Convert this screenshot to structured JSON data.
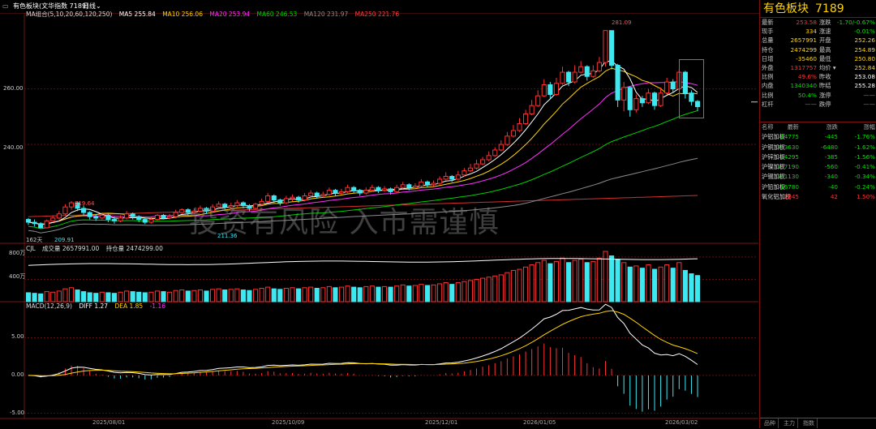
{
  "topbar": {
    "icon": "chart-icon",
    "title": "有色板块(文华指数 7189)",
    "period": "日线"
  },
  "legend_main": {
    "ma_group": "MA组合(5,10,20,60,120,250)",
    "ma5": "MA5 255.84",
    "ma10": "MA10 256.06",
    "ma20": "MA20 253.94",
    "ma60": "MA60 246.53",
    "ma120": "MA120 231.97",
    "ma250": "MA250 221.76"
  },
  "legend_vol": {
    "name": "CJL",
    "vol": "成交量 2657991.00",
    "oi": "持仓量 2474299.00"
  },
  "legend_macd": {
    "name": "MACD(12,26,9)",
    "diff": "DIFF 1.27",
    "dea": "DEA 1.85",
    "macd": "-1.16"
  },
  "axis": {
    "main_ticks": [
      "260.00",
      "240.00"
    ],
    "vol_ticks": [
      "800万",
      "400万"
    ],
    "macd_ticks": [
      "5.00",
      "0.00",
      "-5.00"
    ],
    "dates": [
      "2025/08/01",
      "2025/10/09",
      "2025/12/01",
      "2026/01/05",
      "2026/03/02"
    ]
  },
  "annotations": {
    "high": "281.09",
    "high_left": "219.64",
    "low_left": "209.91",
    "low_mid": "211.36",
    "bars_count": "162天"
  },
  "watermark": "投资有风险 入市需谨慎",
  "colors": {
    "up": "#ff3232",
    "down": "#3ee8f0",
    "ma5": "#ffffff",
    "ma10": "#ffd400",
    "ma20": "#ff30ff",
    "ma60": "#00d000",
    "ma120": "#8c8c8c",
    "ma250": "#d03030",
    "highlight": "#e0484a"
  },
  "quote": {
    "title": "有色板块",
    "code": "7189",
    "rows": [
      {
        "l": "最新",
        "v": "253.58",
        "vc": "#ff3232",
        "l2": "涨跌",
        "v2": "-1.70/-0.67%",
        "v2c": "#00e000"
      },
      {
        "l": "现手",
        "v": "334",
        "vc": "#ffd400",
        "l2": "涨速",
        "v2": "-0.01%",
        "v2c": "#00e000"
      },
      {
        "l": "总量",
        "v": "2657991",
        "vc": "#ffd400",
        "l2": "开盘",
        "v2": "252.26",
        "v2c": "#ffd400"
      },
      {
        "l": "持仓",
        "v": "2474299",
        "vc": "#ffd400",
        "l2": "最高",
        "v2": "254.89",
        "v2c": "#ffd400"
      },
      {
        "l": "日增",
        "v": "-35460",
        "vc": "#ffd400",
        "l2": "最低",
        "v2": "250.80",
        "v2c": "#ffd400"
      },
      {
        "l": "外盘",
        "v": "1317757",
        "vc": "#ff3232",
        "l2": "均价 ▾",
        "v2": "252.84",
        "v2c": "#ffd400"
      },
      {
        "l": "比例",
        "v": "49.6%",
        "vc": "#ff3232",
        "l2": "昨收",
        "v2": "253.08",
        "v2c": "#ffffff"
      },
      {
        "l": "内盘",
        "v": "1340340",
        "vc": "#00e000",
        "l2": "昨结",
        "v2": "255.28",
        "v2c": "#ffffff"
      },
      {
        "l": "比例",
        "v": "50.4%",
        "vc": "#00e000",
        "l2": "涨停",
        "v2": "——",
        "v2c": "#888888"
      },
      {
        "l": "杠杆",
        "v": "——",
        "vc": "#888888",
        "l2": "跌停",
        "v2": "——",
        "v2c": "#888888"
      }
    ],
    "list_header": [
      "名称",
      "最新",
      "涨跌",
      "涨幅"
    ],
    "list": [
      {
        "name": "沪铝加权",
        "last": "24775",
        "chg": "-445",
        "pct": "-1.76%",
        "c": "#00e000"
      },
      {
        "name": "沪铜加权",
        "last": "393630",
        "chg": "-6480",
        "pct": "-1.62%",
        "c": "#00e000"
      },
      {
        "name": "沪锌加权",
        "last": "24295",
        "chg": "-385",
        "pct": "-1.56%",
        "c": "#00e000"
      },
      {
        "name": "沪镍加权",
        "last": "137190",
        "chg": "-560",
        "pct": "-0.41%",
        "c": "#00e000"
      },
      {
        "name": "沪锡加权",
        "last": "101130",
        "chg": "-340",
        "pct": "-0.34%",
        "c": "#00e000"
      },
      {
        "name": "沪铅加权",
        "last": "16780",
        "chg": "-40",
        "pct": "-0.24%",
        "c": "#00e000"
      },
      {
        "name": "氧化铝加权",
        "last": "2845",
        "chg": "42",
        "pct": "1.50%",
        "c": "#ff3232"
      }
    ],
    "tabs": [
      "品种",
      "主力",
      "指数"
    ]
  },
  "chart_data": {
    "type": "candlestick",
    "note_units": "price index; volume in units of 万 (10k lots)",
    "ylim_main": [
      205,
      285
    ],
    "candles": [
      [
        213,
        212.0,
        213.5,
        211.0
      ],
      [
        212,
        211.5,
        213.0,
        210.5
      ],
      [
        211.5,
        210.0,
        212.0,
        209.9
      ],
      [
        210,
        212.5,
        213.0,
        209.9
      ],
      [
        212.5,
        213.5,
        214.5,
        212.0
      ],
      [
        213.5,
        215.0,
        216.0,
        213.0
      ],
      [
        215,
        217.5,
        218.5,
        214.5
      ],
      [
        217.5,
        219.0,
        219.6,
        216.5
      ],
      [
        219,
        217.0,
        219.5,
        216.0
      ],
      [
        217,
        215.5,
        218.0,
        214.5
      ],
      [
        215.5,
        214.0,
        216.0,
        213.0
      ],
      [
        214,
        213.5,
        215.0,
        212.5
      ],
      [
        213.5,
        214.5,
        215.5,
        213.0
      ],
      [
        214.5,
        213.0,
        215.0,
        212.0
      ],
      [
        213,
        212.5,
        214.0,
        211.5
      ],
      [
        212.5,
        213.5,
        214.5,
        212.0
      ],
      [
        213.5,
        215.0,
        216.0,
        213.0
      ],
      [
        215,
        214.0,
        215.5,
        213.0
      ],
      [
        214,
        213.0,
        214.5,
        212.0
      ],
      [
        213,
        212.0,
        213.5,
        211.3
      ],
      [
        212,
        213.0,
        214.0,
        211.5
      ],
      [
        213,
        214.5,
        215.0,
        212.5
      ],
      [
        214.5,
        213.5,
        215.0,
        213.0
      ],
      [
        213.5,
        214.0,
        215.0,
        213.0
      ],
      [
        214,
        215.5,
        216.5,
        213.5
      ],
      [
        215.5,
        216.5,
        217.0,
        215.0
      ],
      [
        216.5,
        215.5,
        217.0,
        214.5
      ],
      [
        215.5,
        216.0,
        217.0,
        215.0
      ],
      [
        216,
        217.0,
        218.0,
        215.5
      ],
      [
        217,
        216.0,
        217.5,
        215.0
      ],
      [
        216,
        217.5,
        218.5,
        215.5
      ],
      [
        217.5,
        218.5,
        219.5,
        217.0
      ],
      [
        218.5,
        217.5,
        219.0,
        216.5
      ],
      [
        217.5,
        218.0,
        219.0,
        217.0
      ],
      [
        218,
        219.0,
        220.0,
        217.5
      ],
      [
        219,
        218.0,
        219.5,
        217.0
      ],
      [
        218,
        217.0,
        218.5,
        216.0
      ],
      [
        217,
        218.5,
        219.0,
        216.5
      ],
      [
        218.5,
        219.5,
        220.5,
        218.0
      ],
      [
        219.5,
        221.5,
        222.5,
        219.0
      ],
      [
        221.5,
        220.0,
        222.0,
        219.0
      ],
      [
        220,
        219.0,
        220.5,
        218.0
      ],
      [
        219,
        220.5,
        221.5,
        218.5
      ],
      [
        220.5,
        221.0,
        222.0,
        219.5
      ],
      [
        221,
        220.0,
        221.5,
        219.0
      ],
      [
        220,
        221.5,
        222.5,
        219.5
      ],
      [
        221.5,
        222.5,
        223.5,
        221.0
      ],
      [
        222.5,
        221.5,
        223.0,
        220.5
      ],
      [
        221.5,
        222.0,
        223.0,
        221.0
      ],
      [
        222,
        223.5,
        224.5,
        221.5
      ],
      [
        223.5,
        222.5,
        224.0,
        221.5
      ],
      [
        222.5,
        223.0,
        224.0,
        222.0
      ],
      [
        223,
        224.5,
        225.5,
        222.5
      ],
      [
        224.5,
        223.5,
        225.0,
        222.5
      ],
      [
        223.5,
        222.5,
        224.0,
        221.5
      ],
      [
        222.5,
        223.5,
        224.5,
        222.0
      ],
      [
        223.5,
        224.5,
        225.5,
        223.0
      ],
      [
        224.5,
        223.5,
        225.0,
        222.5
      ],
      [
        223.5,
        224.0,
        225.0,
        223.0
      ],
      [
        224,
        223.0,
        224.5,
        222.0
      ],
      [
        223,
        224.5,
        225.5,
        222.5
      ],
      [
        224.5,
        225.5,
        226.5,
        224.0
      ],
      [
        225.5,
        224.5,
        226.0,
        223.5
      ],
      [
        224.5,
        225.0,
        226.0,
        224.0
      ],
      [
        225,
        226.5,
        227.5,
        224.5
      ],
      [
        226.5,
        225.5,
        227.0,
        224.5
      ],
      [
        225.5,
        226.0,
        227.0,
        225.0
      ],
      [
        226,
        227.5,
        228.5,
        225.5
      ],
      [
        227.5,
        228.5,
        230.0,
        227.0
      ],
      [
        228.5,
        227.5,
        229.0,
        226.5
      ],
      [
        227.5,
        229.0,
        230.5,
        227.0
      ],
      [
        229,
        230.5,
        231.5,
        228.5
      ],
      [
        230.5,
        231.5,
        233.0,
        230.0
      ],
      [
        231.5,
        233.0,
        234.5,
        231.0
      ],
      [
        233,
        234.5,
        235.5,
        232.5
      ],
      [
        234.5,
        236.0,
        237.5,
        234.0
      ],
      [
        236,
        238.0,
        239.0,
        235.5
      ],
      [
        238,
        240.0,
        241.5,
        237.5
      ],
      [
        240,
        243.0,
        244.5,
        239.5
      ],
      [
        243,
        245.0,
        247.0,
        242.5
      ],
      [
        245,
        247.5,
        249.5,
        244.5
      ],
      [
        247.5,
        251.0,
        252.5,
        247.0
      ],
      [
        251,
        254.0,
        256.0,
        250.5
      ],
      [
        254,
        257.5,
        259.5,
        253.5
      ],
      [
        257.5,
        261.5,
        263.5,
        257.0
      ],
      [
        261.5,
        258.0,
        262.5,
        256.5
      ],
      [
        258,
        262.0,
        264.0,
        257.5
      ],
      [
        262,
        266.0,
        268.0,
        261.5
      ],
      [
        266,
        262.5,
        266.5,
        261.0
      ],
      [
        262.5,
        266.0,
        268.5,
        262.0
      ],
      [
        266,
        268.0,
        270.0,
        265.5
      ],
      [
        268,
        264.5,
        268.5,
        263.0
      ],
      [
        264.5,
        266.5,
        268.5,
        264.0
      ],
      [
        266.5,
        269.5,
        271.5,
        266.0
      ],
      [
        269.5,
        281.0,
        281.1,
        268.0
      ],
      [
        281,
        268.5,
        281.0,
        267.0
      ],
      [
        268.5,
        256.0,
        269.0,
        253.5
      ],
      [
        256,
        260.5,
        262.5,
        252.0
      ],
      [
        260.5,
        252.5,
        261.0,
        250.0
      ],
      [
        252.5,
        256.5,
        258.0,
        251.5
      ],
      [
        256.5,
        255.0,
        257.5,
        253.5
      ],
      [
        255,
        258.5,
        260.0,
        254.5
      ],
      [
        258.5,
        254.0,
        259.0,
        252.5
      ],
      [
        254,
        258.5,
        260.5,
        253.5
      ],
      [
        258.5,
        262.5,
        264.0,
        258.0
      ],
      [
        262.5,
        260.0,
        263.5,
        258.5
      ],
      [
        260,
        266.0,
        267.0,
        259.5
      ],
      [
        266,
        258.5,
        266.5,
        256.5
      ],
      [
        258.5,
        255.5,
        259.5,
        254.0
      ],
      [
        255.5,
        253.6,
        256.0,
        252.0
      ]
    ],
    "volumes": [
      160,
      150,
      140,
      180,
      170,
      190,
      230,
      250,
      210,
      180,
      160,
      150,
      170,
      160,
      150,
      170,
      190,
      180,
      170,
      160,
      170,
      190,
      180,
      170,
      200,
      210,
      190,
      200,
      210,
      190,
      220,
      230,
      210,
      220,
      230,
      210,
      200,
      220,
      240,
      260,
      230,
      220,
      240,
      250,
      230,
      250,
      260,
      240,
      250,
      270,
      250,
      260,
      280,
      260,
      250,
      270,
      280,
      260,
      270,
      260,
      280,
      300,
      280,
      290,
      310,
      290,
      300,
      320,
      340,
      310,
      340,
      360,
      380,
      400,
      420,
      440,
      460,
      480,
      520,
      560,
      580,
      620,
      660,
      700,
      740,
      680,
      720,
      780,
      700,
      740,
      760,
      700,
      720,
      780,
      900,
      820,
      760,
      700,
      620,
      640,
      600,
      660,
      580,
      620,
      660,
      600,
      700,
      560,
      500,
      468
    ],
    "macd_ylim": [
      -5.5,
      8.5
    ]
  }
}
